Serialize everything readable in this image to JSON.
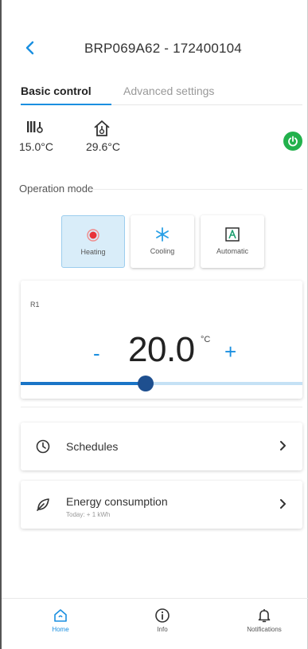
{
  "header": {
    "title": "BRP069A62 - 172400104",
    "back_icon": "chevron-left-icon"
  },
  "tabs": [
    {
      "label": "Basic control",
      "active": true
    },
    {
      "label": "Advanced settings",
      "active": false
    }
  ],
  "temperatures": {
    "outdoor": {
      "icon": "outdoor-temperature-icon",
      "value": "15.0°C"
    },
    "indoor": {
      "icon": "home-temperature-icon",
      "value": "29.6°C"
    }
  },
  "power": {
    "icon": "power-icon",
    "state": "on",
    "color": "#22b14c"
  },
  "operation_mode": {
    "label": "Operation mode",
    "selected": "Heating",
    "options": [
      {
        "label": "Heating",
        "icon": "heating-icon",
        "active": true
      },
      {
        "label": "Cooling",
        "icon": "snowflake-icon",
        "active": false
      },
      {
        "label": "Automatic",
        "icon": "auto-a-icon",
        "active": false
      }
    ]
  },
  "setpoint": {
    "zone": "R1",
    "minus": "-",
    "value": "20.0",
    "unit": "°C",
    "plus": "+",
    "slider_level": 0.44
  },
  "rows": {
    "schedules": {
      "label": "Schedules",
      "icon": "clock-icon"
    },
    "energy": {
      "label": "Energy consumption",
      "sub": "Today: + 1 kWh",
      "icon": "leaf-icon"
    }
  },
  "nav": [
    {
      "label": "Home",
      "icon": "home-icon",
      "active": true
    },
    {
      "label": "Info",
      "icon": "info-icon",
      "active": false
    },
    {
      "label": "Notifications",
      "icon": "bell-icon",
      "active": false
    }
  ],
  "colors": {
    "accent": "#1a8fe0",
    "active_mode_bg": "#d9edf9",
    "slider_dark": "#1e4f8f"
  }
}
